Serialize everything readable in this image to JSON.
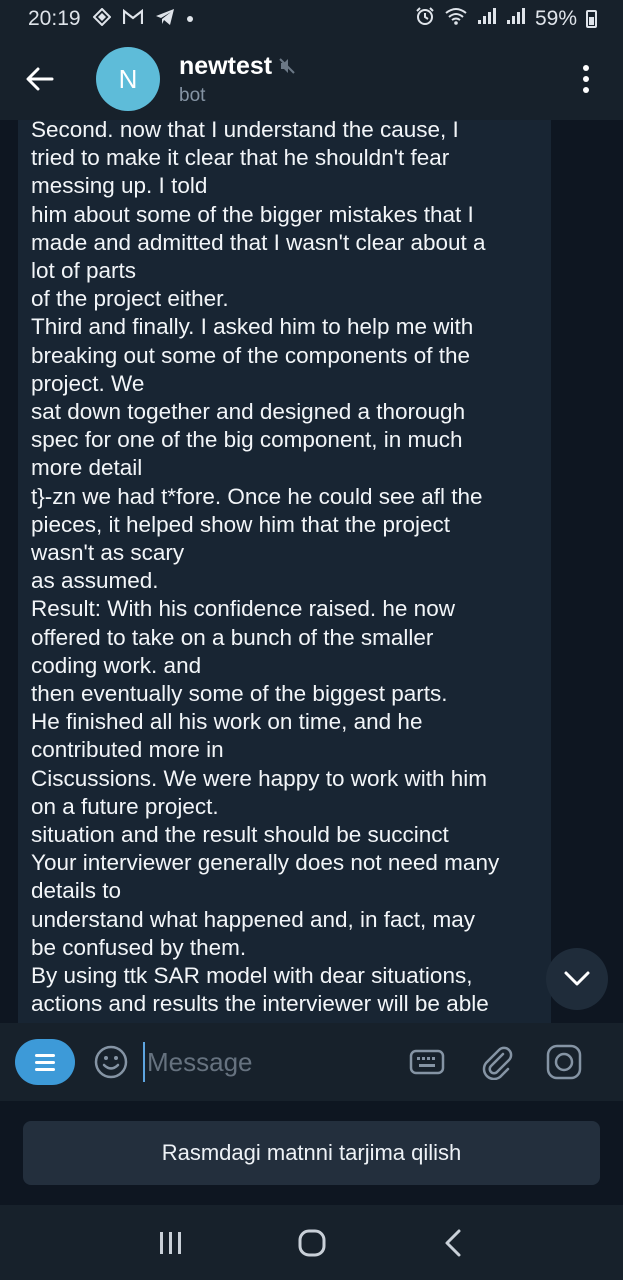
{
  "status_bar": {
    "time": "20:19",
    "battery_percent": "59%",
    "icons": [
      "vpn-icon",
      "gmail-icon",
      "telegram-icon",
      "notification-dot",
      "alarm-icon",
      "wifi-icon",
      "signal-icon",
      "signal-icon",
      "battery-icon"
    ]
  },
  "header": {
    "avatar_letter": "N",
    "title": "newtest",
    "subtitle": "bot",
    "muted": true
  },
  "message": {
    "lines": [
      "Second. now that I understand the cause, I",
      "tried to make it clear that he shouldn't fear",
      "messing up. I told",
      "him about some of the bigger mistakes that I",
      "made and admitted that I wasn't clear about a",
      "lot of parts",
      "of the project either.",
      "Third and finally. I asked him to help me with",
      "breaking out some of the components of the",
      "project. We",
      "sat down together and designed a thorough",
      "spec for one of the big component, in much",
      "more detail",
      "t}-zn we had t*fore. Once he could see afl the",
      "pieces, it helped show him that the project",
      "wasn't as scary",
      "as assumed.",
      "Result: With his confidence raised. he now",
      "offered to take on a bunch of the smaller",
      "coding work. and",
      "then eventually some of the biggest parts.",
      "He finished all his work on time, and he",
      "contributed more in",
      "Ciscussions. We were happy to work with him",
      "on a future project.",
      "situation and the result should be succinct",
      "Your interviewer generally does not need many",
      "details to",
      "understand what happened and, in fact, may",
      "be confused by them.",
      "By using ttk SAR model with dear situations,",
      "actions and results the interviewer will be able"
    ]
  },
  "input": {
    "placeholder": "Message"
  },
  "translate_button": {
    "label": "Rasmdagi matnni tarjima qilish"
  },
  "colors": {
    "background": "#0e1621",
    "header": "#17212b",
    "bubble": "#182533",
    "accent": "#3d9ad8",
    "avatar": "#5ebcd9"
  }
}
